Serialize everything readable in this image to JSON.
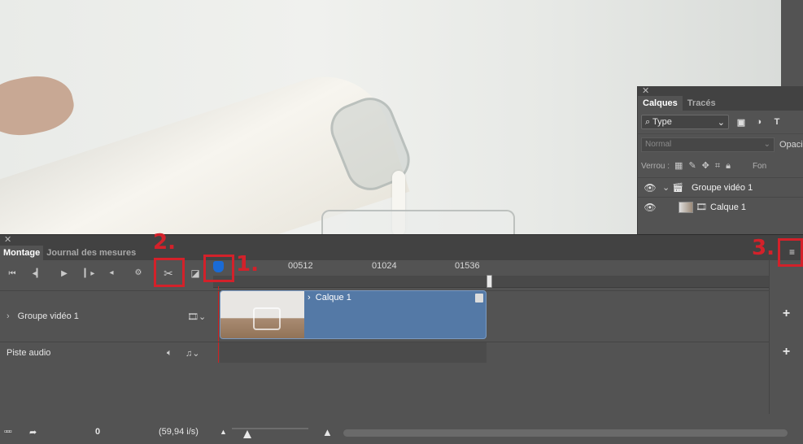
{
  "layers_panel": {
    "tabs": [
      "Calques",
      "Tracés"
    ],
    "active_tab": "Calques",
    "filter_value": "Type",
    "blend_mode": "Normal",
    "opacity_label": "Opaci",
    "lock_label": "Verrou :",
    "fill_label": "Fon",
    "layers": [
      {
        "name": "Groupe vidéo 1",
        "visible": true,
        "expanded": true
      },
      {
        "name": "Calque 1",
        "visible": true
      }
    ]
  },
  "timeline": {
    "tabs": [
      "Montage",
      "Journal des mesures"
    ],
    "active_tab": "Montage",
    "ruler_ticks": [
      "00512",
      "01024",
      "01536"
    ],
    "tracks": [
      {
        "name": "Groupe vidéo 1",
        "clip": "Calque 1"
      },
      {
        "name": "Piste audio"
      }
    ],
    "current_frame": "0",
    "frame_rate": "(59,94 i/s)"
  },
  "annotations": [
    "1.",
    "2.",
    "3."
  ],
  "colors": {
    "annotation": "#d3212a",
    "clip": "#5479a6",
    "playhead": "#d02020"
  }
}
